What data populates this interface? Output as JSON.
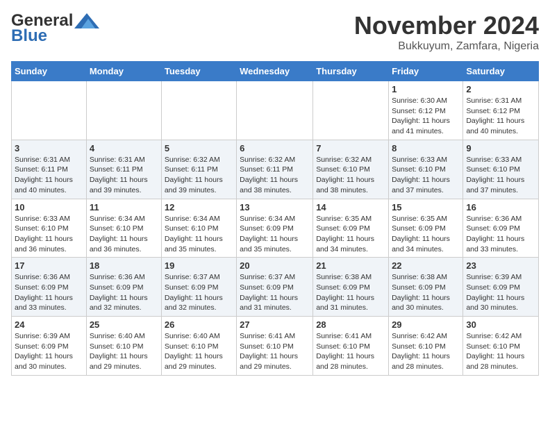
{
  "header": {
    "logo_general": "General",
    "logo_blue": "Blue",
    "month_title": "November 2024",
    "location": "Bukkuyum, Zamfara, Nigeria"
  },
  "weekdays": [
    "Sunday",
    "Monday",
    "Tuesday",
    "Wednesday",
    "Thursday",
    "Friday",
    "Saturday"
  ],
  "weeks": [
    [
      {
        "day": "",
        "info": ""
      },
      {
        "day": "",
        "info": ""
      },
      {
        "day": "",
        "info": ""
      },
      {
        "day": "",
        "info": ""
      },
      {
        "day": "",
        "info": ""
      },
      {
        "day": "1",
        "info": "Sunrise: 6:30 AM\nSunset: 6:12 PM\nDaylight: 11 hours and 41 minutes."
      },
      {
        "day": "2",
        "info": "Sunrise: 6:31 AM\nSunset: 6:12 PM\nDaylight: 11 hours and 40 minutes."
      }
    ],
    [
      {
        "day": "3",
        "info": "Sunrise: 6:31 AM\nSunset: 6:11 PM\nDaylight: 11 hours and 40 minutes."
      },
      {
        "day": "4",
        "info": "Sunrise: 6:31 AM\nSunset: 6:11 PM\nDaylight: 11 hours and 39 minutes."
      },
      {
        "day": "5",
        "info": "Sunrise: 6:32 AM\nSunset: 6:11 PM\nDaylight: 11 hours and 39 minutes."
      },
      {
        "day": "6",
        "info": "Sunrise: 6:32 AM\nSunset: 6:11 PM\nDaylight: 11 hours and 38 minutes."
      },
      {
        "day": "7",
        "info": "Sunrise: 6:32 AM\nSunset: 6:10 PM\nDaylight: 11 hours and 38 minutes."
      },
      {
        "day": "8",
        "info": "Sunrise: 6:33 AM\nSunset: 6:10 PM\nDaylight: 11 hours and 37 minutes."
      },
      {
        "day": "9",
        "info": "Sunrise: 6:33 AM\nSunset: 6:10 PM\nDaylight: 11 hours and 37 minutes."
      }
    ],
    [
      {
        "day": "10",
        "info": "Sunrise: 6:33 AM\nSunset: 6:10 PM\nDaylight: 11 hours and 36 minutes."
      },
      {
        "day": "11",
        "info": "Sunrise: 6:34 AM\nSunset: 6:10 PM\nDaylight: 11 hours and 36 minutes."
      },
      {
        "day": "12",
        "info": "Sunrise: 6:34 AM\nSunset: 6:10 PM\nDaylight: 11 hours and 35 minutes."
      },
      {
        "day": "13",
        "info": "Sunrise: 6:34 AM\nSunset: 6:09 PM\nDaylight: 11 hours and 35 minutes."
      },
      {
        "day": "14",
        "info": "Sunrise: 6:35 AM\nSunset: 6:09 PM\nDaylight: 11 hours and 34 minutes."
      },
      {
        "day": "15",
        "info": "Sunrise: 6:35 AM\nSunset: 6:09 PM\nDaylight: 11 hours and 34 minutes."
      },
      {
        "day": "16",
        "info": "Sunrise: 6:36 AM\nSunset: 6:09 PM\nDaylight: 11 hours and 33 minutes."
      }
    ],
    [
      {
        "day": "17",
        "info": "Sunrise: 6:36 AM\nSunset: 6:09 PM\nDaylight: 11 hours and 33 minutes."
      },
      {
        "day": "18",
        "info": "Sunrise: 6:36 AM\nSunset: 6:09 PM\nDaylight: 11 hours and 32 minutes."
      },
      {
        "day": "19",
        "info": "Sunrise: 6:37 AM\nSunset: 6:09 PM\nDaylight: 11 hours and 32 minutes."
      },
      {
        "day": "20",
        "info": "Sunrise: 6:37 AM\nSunset: 6:09 PM\nDaylight: 11 hours and 31 minutes."
      },
      {
        "day": "21",
        "info": "Sunrise: 6:38 AM\nSunset: 6:09 PM\nDaylight: 11 hours and 31 minutes."
      },
      {
        "day": "22",
        "info": "Sunrise: 6:38 AM\nSunset: 6:09 PM\nDaylight: 11 hours and 30 minutes."
      },
      {
        "day": "23",
        "info": "Sunrise: 6:39 AM\nSunset: 6:09 PM\nDaylight: 11 hours and 30 minutes."
      }
    ],
    [
      {
        "day": "24",
        "info": "Sunrise: 6:39 AM\nSunset: 6:09 PM\nDaylight: 11 hours and 30 minutes."
      },
      {
        "day": "25",
        "info": "Sunrise: 6:40 AM\nSunset: 6:10 PM\nDaylight: 11 hours and 29 minutes."
      },
      {
        "day": "26",
        "info": "Sunrise: 6:40 AM\nSunset: 6:10 PM\nDaylight: 11 hours and 29 minutes."
      },
      {
        "day": "27",
        "info": "Sunrise: 6:41 AM\nSunset: 6:10 PM\nDaylight: 11 hours and 29 minutes."
      },
      {
        "day": "28",
        "info": "Sunrise: 6:41 AM\nSunset: 6:10 PM\nDaylight: 11 hours and 28 minutes."
      },
      {
        "day": "29",
        "info": "Sunrise: 6:42 AM\nSunset: 6:10 PM\nDaylight: 11 hours and 28 minutes."
      },
      {
        "day": "30",
        "info": "Sunrise: 6:42 AM\nSunset: 6:10 PM\nDaylight: 11 hours and 28 minutes."
      }
    ]
  ]
}
